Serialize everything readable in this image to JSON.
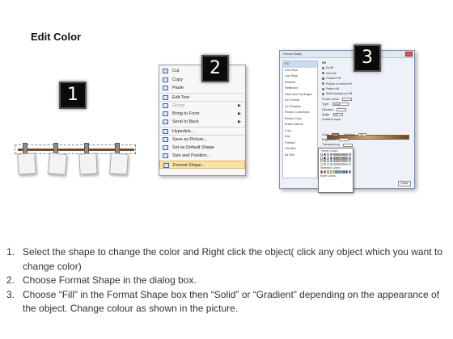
{
  "title": "Edit Color",
  "badges": [
    "1",
    "2",
    "3"
  ],
  "context_menu": {
    "items": [
      {
        "label": "Cut",
        "icon": "cut-icon",
        "disabled": false,
        "submenu": false
      },
      {
        "label": "Copy",
        "icon": "copy-icon",
        "disabled": false,
        "submenu": false
      },
      {
        "label": "Paste",
        "icon": "paste-icon",
        "disabled": false,
        "submenu": false
      },
      {
        "label": "Edit Text",
        "icon": "edit-text-icon",
        "disabled": false,
        "submenu": false
      },
      {
        "label": "Group",
        "icon": "group-icon",
        "disabled": true,
        "submenu": true
      },
      {
        "label": "Bring to Front",
        "icon": "bring-front-icon",
        "disabled": false,
        "submenu": true
      },
      {
        "label": "Send to Back",
        "icon": "send-back-icon",
        "disabled": false,
        "submenu": true
      },
      {
        "label": "Hyperlink...",
        "icon": "hyperlink-icon",
        "disabled": false,
        "submenu": false
      },
      {
        "label": "Save as Picture...",
        "icon": "save-picture-icon",
        "disabled": false,
        "submenu": false
      },
      {
        "label": "Set as Default Shape",
        "icon": "default-shape-icon",
        "disabled": false,
        "submenu": false
      },
      {
        "label": "Size and Position...",
        "icon": "size-position-icon",
        "disabled": false,
        "submenu": false
      },
      {
        "label": "Format Shape...",
        "icon": "format-shape-icon",
        "disabled": false,
        "submenu": false,
        "active": true
      }
    ]
  },
  "format_dialog": {
    "title": "Format Shape",
    "sidebar": [
      "Fill",
      "Line Color",
      "Line Style",
      "Shadow",
      "Reflection",
      "Glow and Soft Edges",
      "3-D Format",
      "3-D Rotation",
      "Picture Corrections",
      "Picture Color",
      "Artistic Effects",
      "Crop",
      "Size",
      "Position",
      "Text Box",
      "Alt Text"
    ],
    "section": "Fill",
    "fill_options": [
      {
        "label": "No fill",
        "selected": false
      },
      {
        "label": "Solid fill",
        "selected": false
      },
      {
        "label": "Gradient fill",
        "selected": true
      },
      {
        "label": "Picture or texture fill",
        "selected": false
      },
      {
        "label": "Pattern fill",
        "selected": false
      },
      {
        "label": "Slide background fill",
        "selected": false
      }
    ],
    "controls": [
      {
        "label": "Preset colors:"
      },
      {
        "label": "Type:",
        "value": "Linear"
      },
      {
        "label": "Direction:"
      },
      {
        "label": "Angle:",
        "value": "0°"
      },
      {
        "label": "Gradient stops"
      }
    ],
    "color_label": "Color",
    "position_label": "Position:",
    "position_value": "0%",
    "brightness_label": "Brightness:",
    "transparency_label": "Transparency:",
    "rotate_label": "Rotate with shape",
    "popup": {
      "theme_label": "Theme Colors",
      "standard_label": "Standard Colors",
      "more_label": "More Colors...",
      "theme_colors": [
        "#ffffff",
        "#000000",
        "#eeece1",
        "#1f497d",
        "#4f81bd",
        "#c0504d",
        "#9bbb59",
        "#8064a2",
        "#4bacc6",
        "#f79646"
      ],
      "standard_colors": [
        "#c00000",
        "#ff0000",
        "#ffc000",
        "#ffff00",
        "#92d050",
        "#00b050",
        "#00b0f0",
        "#0070c0",
        "#002060",
        "#7030a0"
      ]
    },
    "close_label": "Close"
  },
  "steps": [
    {
      "num": "1.",
      "text": "Select the shape to change the color and Right click the object( click any object which you want to change color)"
    },
    {
      "num": "2.",
      "text": "Choose Format Shape in the dialog box."
    },
    {
      "num": "3.",
      "text": "Choose “Fill” in the Format Shape box then “Solid” or “Gradient” depending on the appearance of the object. Change colour as shown in the picture."
    }
  ]
}
